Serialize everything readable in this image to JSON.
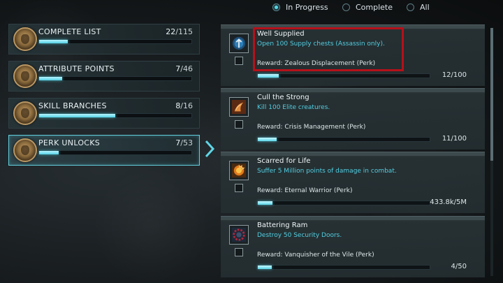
{
  "filters": [
    {
      "label": "In Progress",
      "selected": true
    },
    {
      "label": "Complete",
      "selected": false
    },
    {
      "label": "All",
      "selected": false
    }
  ],
  "categories": [
    {
      "name": "COMPLETE LIST",
      "done": "22",
      "total": "/115",
      "progress_fraction": 0.19,
      "active": false
    },
    {
      "name": "ATTRIBUTE POINTS",
      "done": "7",
      "total": "/46",
      "progress_fraction": 0.15,
      "active": false
    },
    {
      "name": "SKILL BRANCHES",
      "done": "8",
      "total": "/16",
      "progress_fraction": 0.5,
      "active": false
    },
    {
      "name": "PERK UNLOCKS",
      "done": "7",
      "total": "/53",
      "progress_fraction": 0.13,
      "active": true
    }
  ],
  "achievements": [
    {
      "title": "Well Supplied",
      "description": "Open 100 Supply chests (Assassin only).",
      "reward": "Reward: Zealous Displacement (Perk)",
      "count": "12/100",
      "progress_fraction": 0.12,
      "icon": "shield-emblem-icon"
    },
    {
      "title": "Cull the Strong",
      "description": "Kill 100 Elite creatures.",
      "reward": "Reward: Crisis Management (Perk)",
      "count": "11/100",
      "progress_fraction": 0.11,
      "icon": "claw-emblem-icon"
    },
    {
      "title": "Scarred for Life",
      "description": "Suffer 5 Million points of damage in combat.",
      "reward": "Reward: Eternal Warrior (Perk)",
      "count": "433.8k/5M",
      "progress_fraction": 0.087,
      "icon": "flame-emblem-icon"
    },
    {
      "title": "Battering Ram",
      "description": "Destroy 50 Security Doors.",
      "reward": "Reward: Vanquisher of the Vile (Perk)",
      "count": "4/50",
      "progress_fraction": 0.08,
      "icon": "gear-emblem-icon"
    }
  ],
  "colors": {
    "accent": "#56d6e6",
    "highlight": "#b5111a"
  }
}
